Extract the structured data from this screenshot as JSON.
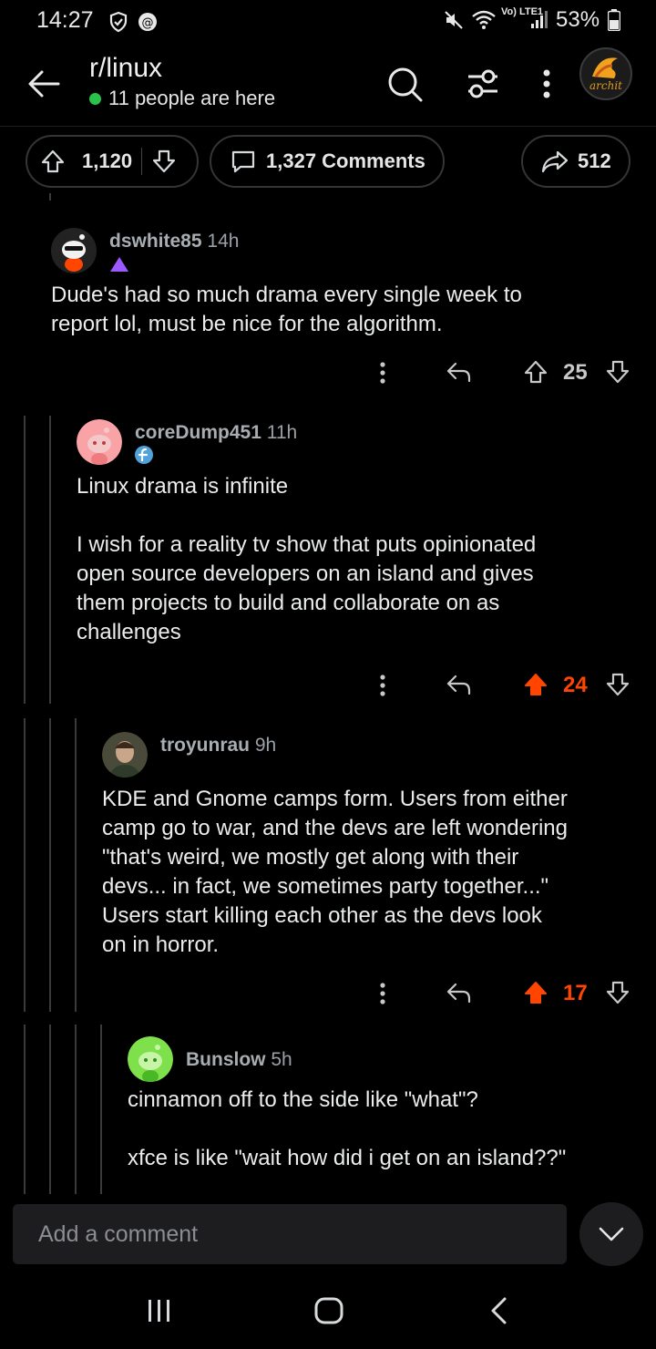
{
  "status_bar": {
    "time": "14:27",
    "battery": "53%",
    "network": "Vo) LTE1"
  },
  "header": {
    "subreddit": "r/linux",
    "online": "11 people are here",
    "profile_logo_text": "archit"
  },
  "actions": {
    "upvotes": "1,120",
    "comments": "1,327 Comments",
    "shares": "512"
  },
  "comments": [
    {
      "user": "dswhite85",
      "time": "14h",
      "text": "Dude's had so much drama every single week to\nreport lol, must be nice for the algorithm.",
      "votes": "25",
      "upvoted": false
    },
    {
      "user": "coreDump451",
      "time": "11h",
      "text": "Linux drama is infinite\n\nI wish for a reality tv show that puts opinionated\nopen source developers on an island and gives\nthem projects to build and collaborate on as\nchallenges",
      "votes": "24",
      "upvoted": true
    },
    {
      "user": "troyunrau",
      "time": "9h",
      "text": "KDE and Gnome camps form. Users from either\ncamp go to war, and the devs are left wondering\n\"that's weird, we mostly get along with their\ndevs... in fact, we sometimes party together...\"\nUsers start killing each other as the devs look\non in horror.",
      "votes": "17",
      "upvoted": true
    },
    {
      "user": "Bunslow",
      "time": "5h",
      "text": "cinnamon off to the side like \"what\"?\n\nxfce is like \"wait how did i get on an island??\"",
      "votes": "",
      "upvoted": false
    }
  ],
  "composer": {
    "placeholder": "Add a comment"
  },
  "colors": {
    "accent": "#ff4500",
    "online": "#2bc24b",
    "background": "#000000"
  }
}
